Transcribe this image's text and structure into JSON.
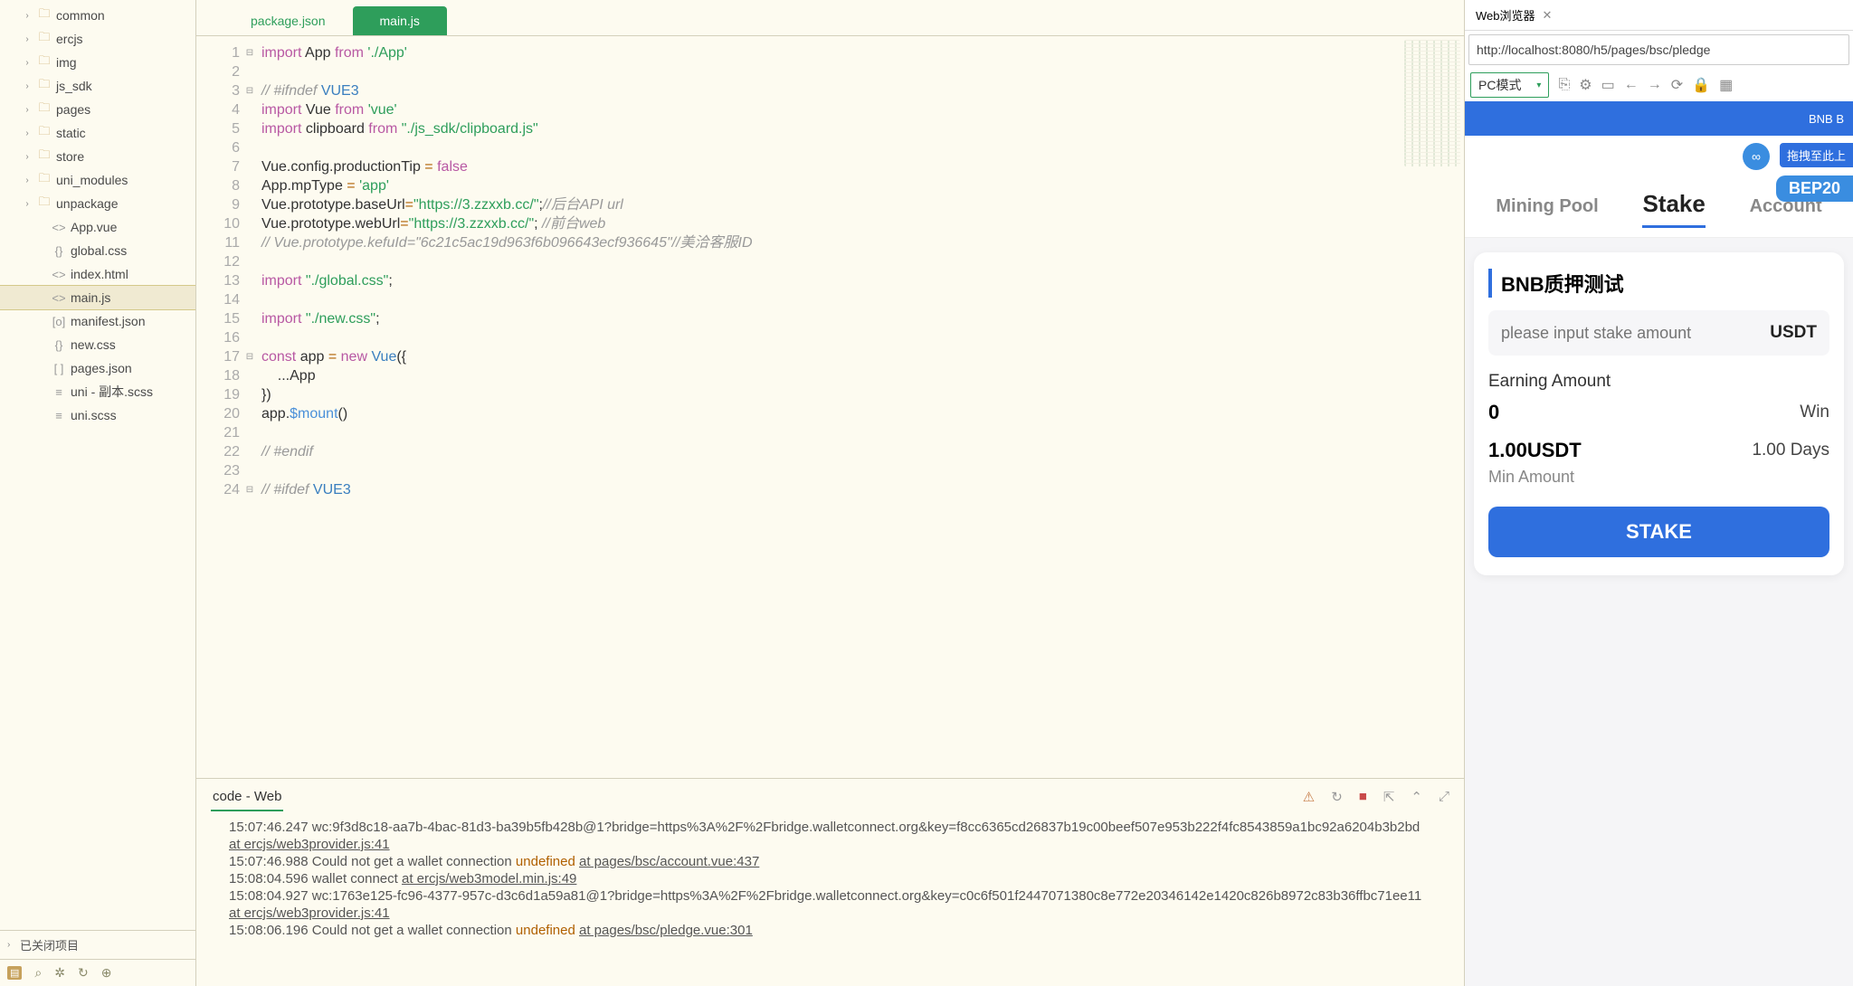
{
  "sidebar": {
    "items": [
      {
        "type": "folder",
        "name": "common"
      },
      {
        "type": "folder",
        "name": "ercjs"
      },
      {
        "type": "folder",
        "name": "img"
      },
      {
        "type": "folder",
        "name": "js_sdk"
      },
      {
        "type": "folder",
        "name": "pages"
      },
      {
        "type": "folder",
        "name": "static"
      },
      {
        "type": "folder",
        "name": "store"
      },
      {
        "type": "folder",
        "name": "uni_modules"
      },
      {
        "type": "folder",
        "name": "unpackage"
      },
      {
        "type": "file",
        "name": "App.vue",
        "icon": "<>"
      },
      {
        "type": "file",
        "name": "global.css",
        "icon": "{}"
      },
      {
        "type": "file",
        "name": "index.html",
        "icon": "<>"
      },
      {
        "type": "file",
        "name": "main.js",
        "icon": "<>",
        "selected": true
      },
      {
        "type": "file",
        "name": "manifest.json",
        "icon": "[o]"
      },
      {
        "type": "file",
        "name": "new.css",
        "icon": "{}"
      },
      {
        "type": "file",
        "name": "pages.json",
        "icon": "[ ]"
      },
      {
        "type": "file",
        "name": "uni - 副本.scss",
        "icon": "≡"
      },
      {
        "type": "file",
        "name": "uni.scss",
        "icon": "≡"
      }
    ],
    "closed_projects_label": "已关闭项目"
  },
  "tabs": [
    {
      "label": "package.json",
      "active": false
    },
    {
      "label": "main.js",
      "active": true
    }
  ],
  "code": {
    "lines": [
      {
        "n": 1,
        "fold": "⊟",
        "html": "<span class='kw'>import</span> <span class='id'>App</span> <span class='kw'>from</span> <span class='str'>'./App'</span>"
      },
      {
        "n": 2,
        "html": ""
      },
      {
        "n": 3,
        "fold": "⊟",
        "html": "<span class='cm'>// #ifndef </span><span class='cls'>VUE3</span>"
      },
      {
        "n": 4,
        "html": "<span class='kw'>import</span> <span class='id'>Vue</span> <span class='kw'>from</span> <span class='str'>'vue'</span>"
      },
      {
        "n": 5,
        "html": "<span class='kw'>import</span> <span class='id'>clipboard</span> <span class='kw'>from</span> <span class='str'>\"./js_sdk/clipboard.js\"</span>"
      },
      {
        "n": 6,
        "html": ""
      },
      {
        "n": 7,
        "html": "<span class='id'>Vue</span>.<span class='id'>config</span>.<span class='id'>productionTip</span> <span class='op'>=</span> <span class='kw'>false</span>"
      },
      {
        "n": 8,
        "html": "<span class='id'>App</span>.<span class='id'>mpType</span> <span class='op'>=</span> <span class='str'>'app'</span>"
      },
      {
        "n": 9,
        "html": "<span class='id'>Vue</span>.<span class='id'>prototype</span>.<span class='id'>baseUrl</span><span class='op'>=</span><span class='str'>\"https://3.zzxxb.cc/\"</span>;<span class='cm'>//后台API url</span>"
      },
      {
        "n": 10,
        "html": "<span class='id'>Vue</span>.<span class='id'>prototype</span>.<span class='id'>webUrl</span><span class='op'>=</span><span class='str'>\"https://3.zzxxb.cc/\"</span>; <span class='cm'>//前台web</span>"
      },
      {
        "n": 11,
        "html": "<span class='cm'>// Vue.prototype.kefuId=\"6c21c5ac19d963f6b096643ecf936645\"//美洽客服ID</span>"
      },
      {
        "n": 12,
        "html": ""
      },
      {
        "n": 13,
        "html": "<span class='kw'>import</span> <span class='str'>\"./global.css\"</span>;"
      },
      {
        "n": 14,
        "html": ""
      },
      {
        "n": 15,
        "html": "<span class='kw'>import</span> <span class='str'>\"./new.css\"</span>;"
      },
      {
        "n": 16,
        "html": ""
      },
      {
        "n": 17,
        "fold": "⊟",
        "html": "<span class='kw'>const</span> <span class='id'>app</span> <span class='op'>=</span> <span class='kw'>new</span> <span class='cls'>Vue</span>({"
      },
      {
        "n": 18,
        "html": "    ...<span class='id'>App</span>"
      },
      {
        "n": 19,
        "html": "})"
      },
      {
        "n": 20,
        "html": "<span class='id'>app</span>.<span class='prop'>$mount</span>()"
      },
      {
        "n": 21,
        "html": ""
      },
      {
        "n": 22,
        "html": "<span class='cm'>// #endif</span>"
      },
      {
        "n": 23,
        "html": ""
      },
      {
        "n": 24,
        "fold": "⊟",
        "html": "<span class='cm'>// #ifdef </span><span class='cls'>VUE3</span>"
      }
    ]
  },
  "console": {
    "tab_label": "code - Web",
    "lines": [
      {
        "ts": "15:07:46.247",
        "text": "wc:9f3d8c18-aa7b-4bac-81d3-ba39b5fb428b@1?bridge=https%3A%2F%2Fbridge.walletconnect.org&key=f8cc6365cd26837b19c00beef507e953b222f4fc8543859a1bc92a6204b3b2bd ",
        "link": "at ercjs/web3provider.js:41"
      },
      {
        "ts": "15:07:46.988",
        "text": "Could not get a wallet connection ",
        "undef": "undefined",
        "link": "at pages/bsc/account.vue:437"
      },
      {
        "ts": "15:08:04.596",
        "text": "wallet connect ",
        "link": "at ercjs/web3model.min.js:49"
      },
      {
        "ts": "15:08:04.927",
        "text": "wc:1763e125-fc96-4377-957c-d3c6d1a59a81@1?bridge=https%3A%2F%2Fbridge.walletconnect.org&key=c0c6f501f2447071380c8e772e20346142e1420c826b8972c83b36ffbc71ee11 ",
        "link": "at ercjs/web3provider.js:41"
      },
      {
        "ts": "15:08:06.196",
        "text": "Could not get a wallet connection ",
        "undef": "undefined",
        "link": "at pages/bsc/pledge.vue:301"
      }
    ]
  },
  "browser": {
    "tab_label": "Web浏览器",
    "url": "http://localhost:8080/h5/pages/bsc/pledge",
    "mode": "PC模式",
    "topbar_text": "BNB B",
    "float_label": "拖拽至此上",
    "bep_badge": "BEP20",
    "tabs": [
      {
        "label": "Mining Pool",
        "active": false
      },
      {
        "label": "Stake",
        "active": true
      },
      {
        "label": "Account",
        "active": false
      }
    ],
    "card": {
      "title": "BNB质押测试",
      "placeholder": "please input stake amount",
      "unit": "USDT",
      "earning_label": "Earning Amount",
      "earning_value": "0",
      "earning_right": "Win",
      "min_value": "1.00USDT",
      "min_label": "Min Amount",
      "days": "1.00 Days",
      "button": "STAKE"
    }
  }
}
